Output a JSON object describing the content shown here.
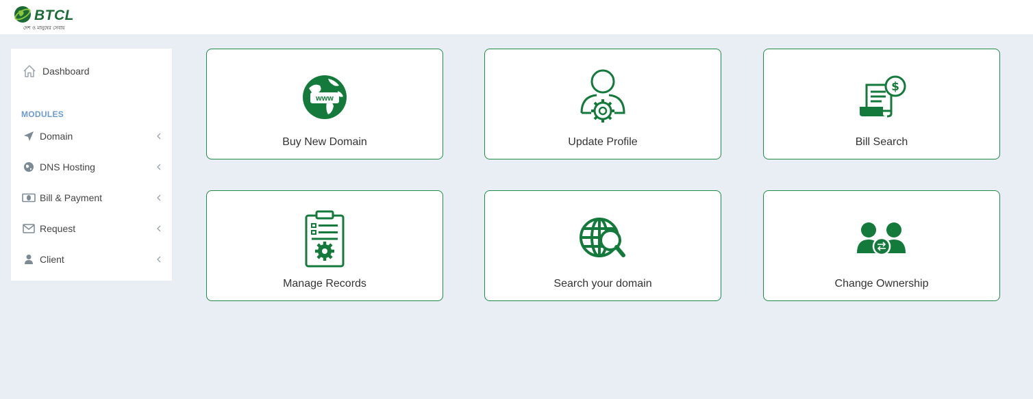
{
  "header": {
    "logo_text": "BTCL",
    "logo_tagline": "দেশ ও মানুষের সেবায়"
  },
  "sidebar": {
    "dashboard_label": "Dashboard",
    "modules_heading": "MODULES",
    "items": [
      {
        "label": "Domain",
        "icon": "paper-plane-icon"
      },
      {
        "label": "DNS Hosting",
        "icon": "globe-icon"
      },
      {
        "label": "Bill & Payment",
        "icon": "money-icon"
      },
      {
        "label": "Request",
        "icon": "envelope-icon"
      },
      {
        "label": "Client",
        "icon": "user-icon"
      }
    ]
  },
  "cards": [
    {
      "label": "Buy New Domain",
      "icon": "www-globe-icon"
    },
    {
      "label": "Update Profile",
      "icon": "profile-gear-icon"
    },
    {
      "label": "Bill Search",
      "icon": "bill-dollar-icon"
    },
    {
      "label": "Manage Records",
      "icon": "clipboard-gear-icon"
    },
    {
      "label": "Search your domain",
      "icon": "globe-search-icon"
    },
    {
      "label": "Change Ownership",
      "icon": "users-exchange-icon"
    }
  ],
  "colors": {
    "accent_green": "#1e8a45",
    "icon_green": "#137a3b",
    "background": "#e9edf4",
    "modules_heading": "#6a9ad0"
  }
}
